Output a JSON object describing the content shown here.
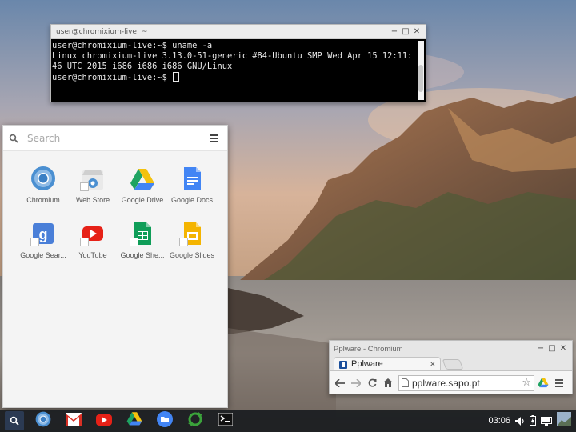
{
  "terminal": {
    "title": "user@chromixium-live: ~",
    "lines": [
      "user@chromixium-live:~$ uname -a",
      "Linux chromixium-live 3.13.0-51-generic #84-Ubuntu SMP Wed Apr 15 12:11:",
      "46 UTC 2015 i686 i686 i686 GNU/Linux",
      "user@chromixium-live:~$ "
    ]
  },
  "window_buttons": {
    "minimize": "−",
    "maximize": "□",
    "close": "✕"
  },
  "launcher": {
    "search_placeholder": "Search",
    "menu_icon": "hamburger-icon",
    "apps": [
      {
        "label": "Chromium",
        "icon": "chromium-icon"
      },
      {
        "label": "Web Store",
        "icon": "web-store-icon"
      },
      {
        "label": "Google Drive",
        "icon": "google-drive-icon"
      },
      {
        "label": "Google Docs",
        "icon": "google-docs-icon"
      },
      {
        "label": "Google Sear...",
        "icon": "google-search-icon"
      },
      {
        "label": "YouTube",
        "icon": "youtube-icon"
      },
      {
        "label": "Google She...",
        "icon": "google-sheets-icon"
      },
      {
        "label": "Google Slides",
        "icon": "google-slides-icon"
      }
    ]
  },
  "chromium": {
    "title": "Pplware - Chromium",
    "tab_label": "Pplware",
    "tab_close": "×",
    "url": "pplware.sapo.pt"
  },
  "shelf": {
    "apps": [
      "search-icon",
      "chromium-icon",
      "gmail-icon",
      "youtube-icon",
      "google-drive-icon",
      "files-icon",
      "refresh-app-icon",
      "terminal-icon"
    ],
    "clock": "03:06"
  },
  "colors": {
    "accent": "#4285f4",
    "shelf_bg": "#191c20",
    "terminal_bg": "#000000"
  }
}
